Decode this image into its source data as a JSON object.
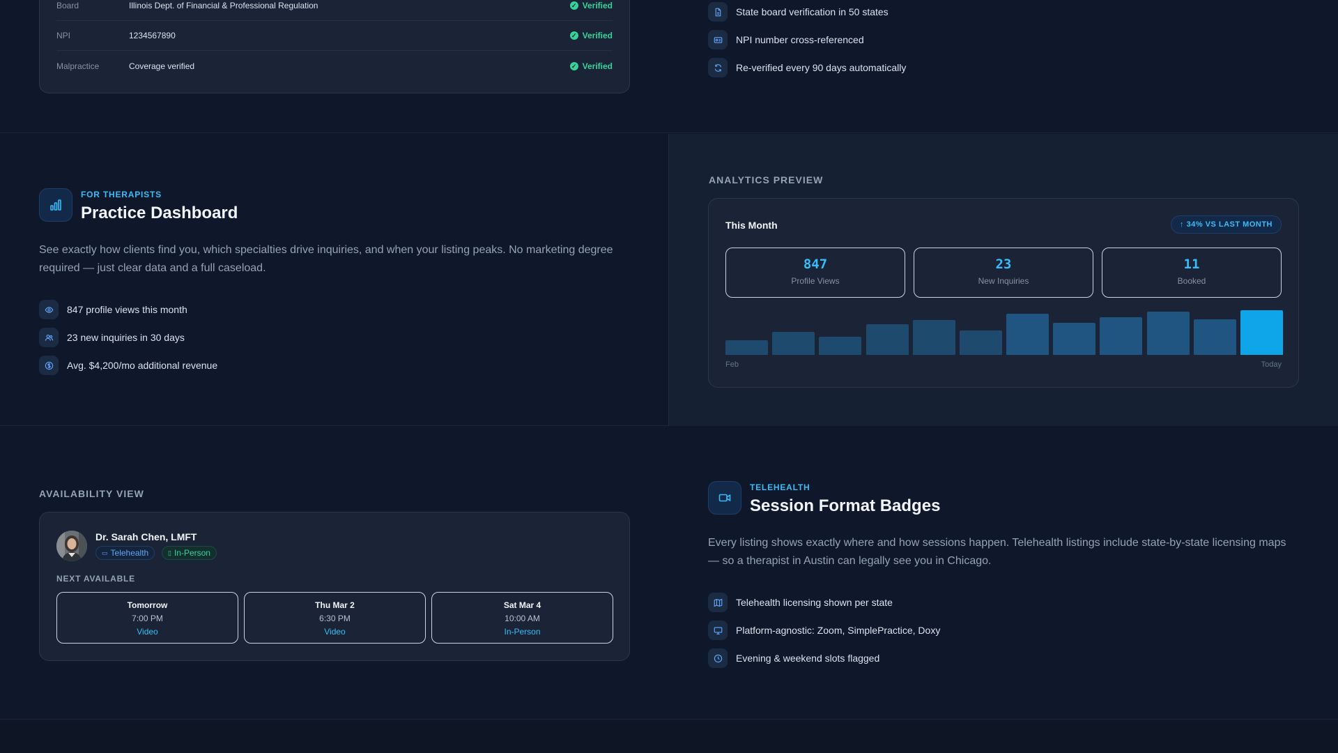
{
  "verification": {
    "rows": [
      {
        "label": "Board",
        "value": "Illinois Dept. of Financial & Professional Regulation",
        "status": "Verified"
      },
      {
        "label": "NPI",
        "value": "1234567890",
        "status": "Verified"
      },
      {
        "label": "Malpractice",
        "value": "Coverage verified",
        "status": "Verified"
      }
    ],
    "features": [
      "State board verification in 50 states",
      "NPI number cross-referenced",
      "Re-verified every 90 days automatically"
    ]
  },
  "dashboard": {
    "eyebrow": "FOR THERAPISTS",
    "title": "Practice Dashboard",
    "description": "See exactly how clients find you, which specialties drive inquiries, and when your listing peaks. No marketing degree required — just clear data and a full caseload.",
    "features": [
      "847 profile views this month",
      "23 new inquiries in 30 days",
      "Avg. $4,200/mo additional revenue"
    ]
  },
  "analytics": {
    "section_label": "ANALYTICS PREVIEW",
    "card_title": "This Month",
    "change_pill": "↑ 34% VS LAST MONTH",
    "stats": [
      {
        "value": "847",
        "label": "Profile Views"
      },
      {
        "value": "23",
        "label": "New Inquiries"
      },
      {
        "value": "11",
        "label": "Booked"
      }
    ],
    "x_start": "Feb",
    "x_end": "Today",
    "bar_levels": [
      0.33,
      0.52,
      0.4,
      0.68,
      0.78,
      0.55,
      0.92,
      0.72,
      0.85,
      0.97,
      0.79,
      1.0
    ],
    "colors": {
      "bar": "#1e4a6e",
      "bar_mid": "#1f5580",
      "bar_active": "#0ea5e9"
    }
  },
  "availability": {
    "section_label": "AVAILABILITY VIEW",
    "therapist_name": "Dr. Sarah Chen, LMFT",
    "tags": [
      "Telehealth",
      "In-Person"
    ],
    "next_label": "NEXT AVAILABLE",
    "slots": [
      {
        "day": "Tomorrow",
        "time": "7:00 PM",
        "format": "Video"
      },
      {
        "day": "Thu Mar 2",
        "time": "6:30 PM",
        "format": "Video"
      },
      {
        "day": "Sat Mar 4",
        "time": "10:00 AM",
        "format": "In-Person"
      }
    ]
  },
  "telehealth": {
    "eyebrow": "TELEHEALTH",
    "title": "Session Format Badges",
    "description": "Every listing shows exactly where and how sessions happen. Telehealth listings include state-by-state licensing maps — so a therapist in Austin can legally see you in Chicago.",
    "features": [
      "Telehealth licensing shown per state",
      "Platform-agnostic: Zoom, SimplePractice, Doxy",
      "Evening & weekend slots flagged"
    ]
  },
  "icons": {
    "verification": [
      "document-icon",
      "id-card-icon",
      "refresh-icon"
    ],
    "dashboard_header": "bar-chart-icon",
    "dashboard": [
      "eye-icon",
      "users-icon",
      "dollar-icon"
    ],
    "telehealth_header": "video-camera-icon",
    "telehealth": [
      "map-icon",
      "monitor-icon",
      "clock-icon"
    ]
  }
}
